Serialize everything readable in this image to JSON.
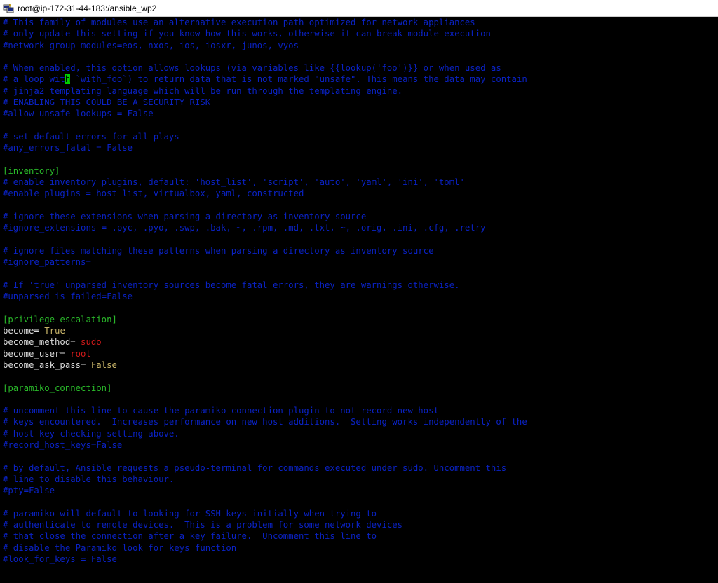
{
  "window": {
    "title": "root@ip-172-31-44-183:/ansible_wp2"
  },
  "colors": {
    "comment": "#0a22c4",
    "section": "#2ab92a",
    "key": "#d9d9d9",
    "value_bool": "#c8b469",
    "value_string": "#d11a1a",
    "cursor": "#00d000",
    "background": "#000000"
  },
  "terminal": {
    "lines": {
      "l01": "# This family of modules use an alternative execution path optimized for network appliances",
      "l02": "# only update this setting if you know how this works, otherwise it can break module execution",
      "l03": "#network_group_modules=eos, nxos, ios, iosxr, junos, vyos",
      "l04": "",
      "l05a": "# When enabled, this option allows lookups (via variables like {{lookup('foo')}} or when used as",
      "l06a": "# a loop with `with_foo`) to return data that is not marked \"unsafe\". This means the data may contain",
      "l07": "# jinja2 templating language which will be run through the templating engine.",
      "l08": "# ENABLING THIS COULD BE A SECURITY RISK",
      "l09": "#allow_unsafe_lookups = False",
      "l10": "",
      "l11": "# set default errors for all plays",
      "l12": "#any_errors_fatal = False",
      "l13": "",
      "l14": "[inventory]",
      "l15": "# enable inventory plugins, default: 'host_list', 'script', 'auto', 'yaml', 'ini', 'toml'",
      "l16": "#enable_plugins = host_list, virtualbox, yaml, constructed",
      "l17": "",
      "l18": "# ignore these extensions when parsing a directory as inventory source",
      "l19": "#ignore_extensions = .pyc, .pyo, .swp, .bak, ~, .rpm, .md, .txt, ~, .orig, .ini, .cfg, .retry",
      "l20": "",
      "l21": "# ignore files matching these patterns when parsing a directory as inventory source",
      "l22": "#ignore_patterns=",
      "l23": "",
      "l24": "# If 'true' unparsed inventory sources become fatal errors, they are warnings otherwise.",
      "l25": "#unparsed_is_failed=False",
      "l26": "",
      "l27": "[privilege_escalation]",
      "l32": "",
      "l33": "[paramiko_connection]",
      "l34": "",
      "l35": "# uncomment this line to cause the paramiko connection plugin to not record new host",
      "l36": "# keys encountered.  Increases performance on new host additions.  Setting works independently of the",
      "l37": "# host key checking setting above.",
      "l38": "#record_host_keys=False",
      "l39": "",
      "l40": "# by default, Ansible requests a pseudo-terminal for commands executed under sudo. Uncomment this",
      "l41": "# line to disable this behaviour.",
      "l42": "#pty=False",
      "l43": "",
      "l44": "# paramiko will default to looking for SSH keys initially when trying to",
      "l45": "# authenticate to remote devices.  This is a problem for some network devices",
      "l46": "# that close the connection after a key failure.  Uncomment this line to",
      "l47": "# disable the Paramiko look for keys function",
      "l48": "#look_for_keys = False"
    },
    "l05_prefix": "# When enab",
    "l05_suffix": "led, this option allows lookups (via variables like {{lookup('foo')}} or when used as",
    "l06_prefix": "# a loop wit",
    "l06_cursor": "h",
    "l06_suffix": " `with_foo`) to return data that is not marked \"unsafe\". This means the data may contain",
    "l07_prefix": "# jinja2 tem",
    "l07_suffix": "plating language which will be run through the templating engine.",
    "privilege": {
      "become_key": "become=",
      "become_val": " True",
      "method_key": "become_method=",
      "method_val": " sudo",
      "user_key": "become_user=",
      "user_val": " root",
      "ask_key": "become_ask_pass=",
      "ask_val": " False"
    }
  }
}
